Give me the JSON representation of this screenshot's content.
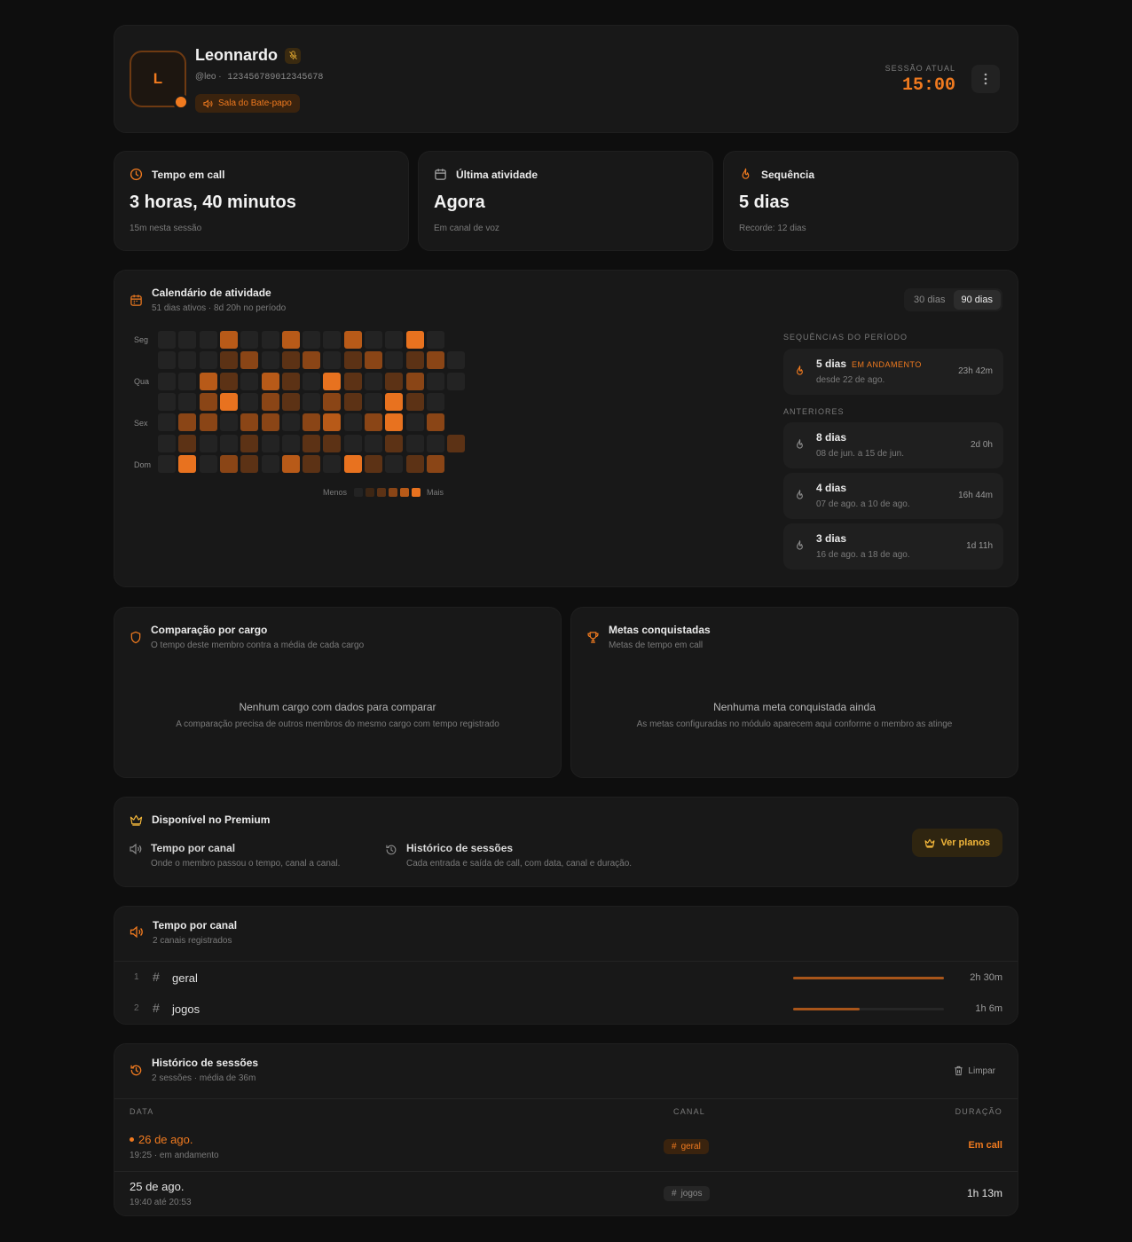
{
  "profile": {
    "initial": "L",
    "name": "Leonnardo",
    "handle": "@leo",
    "separator": "·",
    "user_id": "123456789012345678",
    "room": "Sala do Bate-papo",
    "session_label": "SESSÃO ATUAL",
    "session_time": "15:00"
  },
  "stats": [
    {
      "icon": "clock-icon",
      "title": "Tempo em call",
      "value": "3 horas, 40 minutos",
      "sub": "15m nesta sessão"
    },
    {
      "icon": "calendar-icon",
      "title": "Última atividade",
      "value": "Agora",
      "sub": "Em canal de voz"
    },
    {
      "icon": "flame-icon",
      "title": "Sequência",
      "value": "5 dias",
      "sub": "Recorde: 12 dias"
    }
  ],
  "calendar": {
    "title": "Calendário de atividade",
    "subtitle": "51 dias ativos · 8d 20h no período",
    "ranges": [
      "30 dias",
      "90 dias"
    ],
    "active_range": "90 dias",
    "day_labels": [
      "Seg",
      "Qua",
      "Sex",
      "Dom"
    ],
    "legend_less": "Menos",
    "legend_more": "Mais",
    "colors": [
      "#232323",
      "#3d2614",
      "#5c3215",
      "#8a4516",
      "#b85a18",
      "#e8721f"
    ],
    "grid_levels": [
      [
        0,
        0,
        0,
        4,
        0,
        0,
        4,
        0,
        0,
        4,
        0,
        0,
        5,
        0
      ],
      [
        0,
        0,
        0,
        2,
        3,
        0,
        2,
        3,
        0,
        2,
        3,
        0,
        2,
        3,
        0
      ],
      [
        0,
        0,
        4,
        2,
        0,
        4,
        2,
        0,
        5,
        2,
        0,
        2,
        3,
        0,
        0
      ],
      [
        0,
        0,
        3,
        5,
        0,
        3,
        2,
        0,
        3,
        2,
        0,
        5,
        2,
        0
      ],
      [
        0,
        3,
        3,
        0,
        3,
        3,
        0,
        3,
        4,
        0,
        3,
        5,
        0,
        3
      ],
      [
        0,
        2,
        0,
        0,
        2,
        0,
        0,
        2,
        2,
        0,
        0,
        2,
        0,
        0,
        2
      ],
      [
        0,
        5,
        0,
        3,
        2,
        0,
        4,
        2,
        0,
        5,
        2,
        0,
        2,
        3
      ]
    ],
    "streaks_label": "SEQUÊNCIAS DO PERÍODO",
    "current_streak": {
      "name": "5 dias",
      "tag": "EM ANDAMENTO",
      "date": "desde 22 de ago.",
      "duration": "23h 42m"
    },
    "previous_label": "ANTERIORES",
    "previous_streaks": [
      {
        "name": "8 dias",
        "date": "08 de jun. a 15 de jun.",
        "duration": "2d 0h"
      },
      {
        "name": "4 dias",
        "date": "07 de ago. a 10 de ago.",
        "duration": "16h 44m"
      },
      {
        "name": "3 dias",
        "date": "16 de ago. a 18 de ago.",
        "duration": "1d 11h"
      }
    ]
  },
  "comparison": {
    "title": "Comparação por cargo",
    "subtitle": "O tempo deste membro contra a média de cada cargo",
    "empty_title": "Nenhum cargo com dados para comparar",
    "empty_sub": "A comparação precisa de outros membros do mesmo cargo com tempo registrado"
  },
  "goals": {
    "title": "Metas conquistadas",
    "subtitle": "Metas de tempo em call",
    "empty_title": "Nenhuma meta conquistada ainda",
    "empty_sub": "As metas configuradas no módulo aparecem aqui conforme o membro as atinge"
  },
  "premium": {
    "title": "Disponível no Premium",
    "features": [
      {
        "title": "Tempo por canal",
        "desc": "Onde o membro passou o tempo, canal a canal."
      },
      {
        "title": "Histórico de sessões",
        "desc": "Cada entrada e saída de call, com data, canal e duração."
      }
    ],
    "button": "Ver planos",
    "accent": "#f0b53a"
  },
  "channels": {
    "title": "Tempo por canal",
    "subtitle": "2 canais registrados",
    "hash": "#",
    "items": [
      {
        "rank": "1",
        "name": "geral",
        "time": "2h 30m",
        "share": 1.0
      },
      {
        "rank": "2",
        "name": "jogos",
        "time": "1h 6m",
        "share": 0.44
      }
    ]
  },
  "sessions": {
    "title": "Histórico de sessões",
    "subtitle": "2 sessões · média de 36m",
    "clear": "Limpar",
    "col_date": "DATA",
    "col_channel": "CANAL",
    "col_duration": "DURAÇÃO",
    "rows": [
      {
        "date": "26 de ago.",
        "meta": "19:25 · em andamento",
        "channel": "geral",
        "duration": "Em call",
        "live": true
      },
      {
        "date": "25 de ago.",
        "meta": "19:40 até 20:53",
        "channel": "jogos",
        "duration": "1h 13m",
        "live": false
      }
    ]
  },
  "accent": "#f07a1f"
}
